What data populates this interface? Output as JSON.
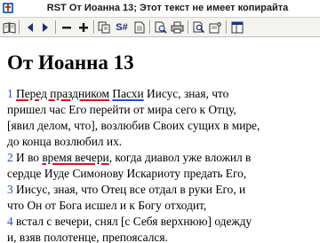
{
  "window": {
    "title": "RST От Иоанна 13; Этот текст не имеет копирайта"
  },
  "toolbar": {
    "buttons": [
      {
        "name": "open-book-icon"
      },
      {
        "name": "back-icon"
      },
      {
        "name": "forward-icon"
      },
      {
        "name": "zoom-out-icon"
      },
      {
        "name": "zoom-in-icon"
      },
      {
        "name": "copy-icon"
      },
      {
        "name": "strongs-icon",
        "label": "S#"
      },
      {
        "name": "document-icon"
      },
      {
        "name": "print-preview-icon"
      },
      {
        "name": "print-icon"
      },
      {
        "name": "search-page-icon"
      },
      {
        "name": "options-icon"
      },
      {
        "name": "panel-icon"
      }
    ],
    "strongs_label": "S#"
  },
  "content": {
    "heading": "От Иоанна 13",
    "lines": [
      [
        {
          "t": "1",
          "c": "vnum"
        },
        {
          "t": " "
        },
        {
          "t": "Перед праздником",
          "c": "u-red"
        },
        {
          "t": " "
        },
        {
          "t": "Пасхи",
          "c": "u-blue"
        },
        {
          "t": " Иисус, зная, что"
        }
      ],
      [
        {
          "t": "пришел час Его перейти от мира сего к Отцу,"
        }
      ],
      [
        {
          "t": "[явил делом, что], возлюбив Своих сущих в мире,"
        }
      ],
      [
        {
          "t": "до конца возлюбил их."
        }
      ],
      [
        {
          "t": "2",
          "c": "vnum"
        },
        {
          "t": " И во "
        },
        {
          "t": "время вечери",
          "c": "u-red"
        },
        {
          "t": ", когда диавол уже вложил в"
        }
      ],
      [
        {
          "t": "сердце Иуде Симонову Искариоту предать Его,"
        }
      ],
      [
        {
          "t": "3",
          "c": "vnum"
        },
        {
          "t": " Иисус, зная, что Отец все отдал в руки Его, и"
        }
      ],
      [
        {
          "t": "что Он от Бога исшел и к Богу отходит,"
        }
      ],
      [
        {
          "t": "4",
          "c": "vnum"
        },
        {
          "t": " встал с вечери, снял [с Себя верхнюю] одежду"
        }
      ],
      [
        {
          "t": "и, взяв полотенце, препоясался."
        }
      ]
    ]
  },
  "colors": {
    "verse_number": "#1f4fbf",
    "underline_red": "#d8141b",
    "underline_blue": "#2050d8",
    "toolbar_bg": "#f4f3ee"
  }
}
